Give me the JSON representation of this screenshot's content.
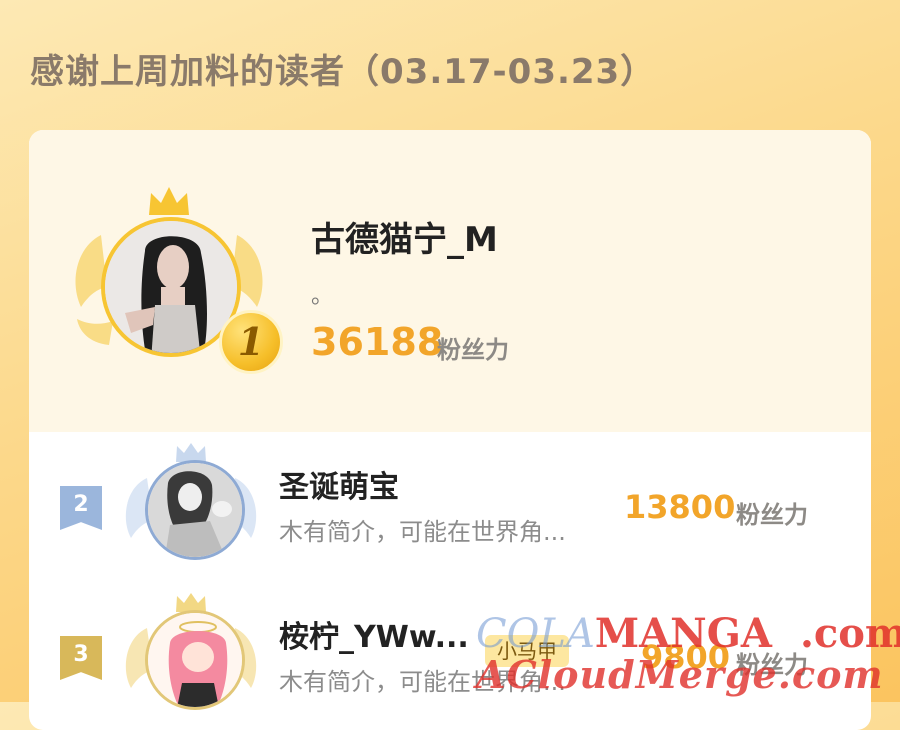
{
  "page": {
    "title": "感谢上周加料的读者（03.17-03.23）"
  },
  "top_reader": {
    "rank": "1",
    "name": "古德猫宁_M",
    "bio": "。",
    "score": "36188",
    "unit": "粉丝力"
  },
  "readers": [
    {
      "rank": "2",
      "name": "圣诞萌宝",
      "bio": "木有简介，可能在世界角...",
      "score": "13800",
      "unit": "粉丝力"
    },
    {
      "rank": "3",
      "name": "桉柠_YWw...",
      "badge": "小马甲",
      "bio": "木有简介，可能在世界角...",
      "score": "9800",
      "unit": "粉丝力"
    }
  ],
  "watermark": {
    "line1_prefix": "COLA",
    "line1_main": "MANGA",
    "line1_suffix": ".com",
    "line2": "ACloudMerge.com"
  },
  "colors": {
    "accent_gold": "#f2a52a",
    "rank1_gold": "#f6bf2a",
    "rank2_blue": "#9bb6dc",
    "rank3_gold": "#d8b85a",
    "watermark_red": "#e0302a"
  }
}
